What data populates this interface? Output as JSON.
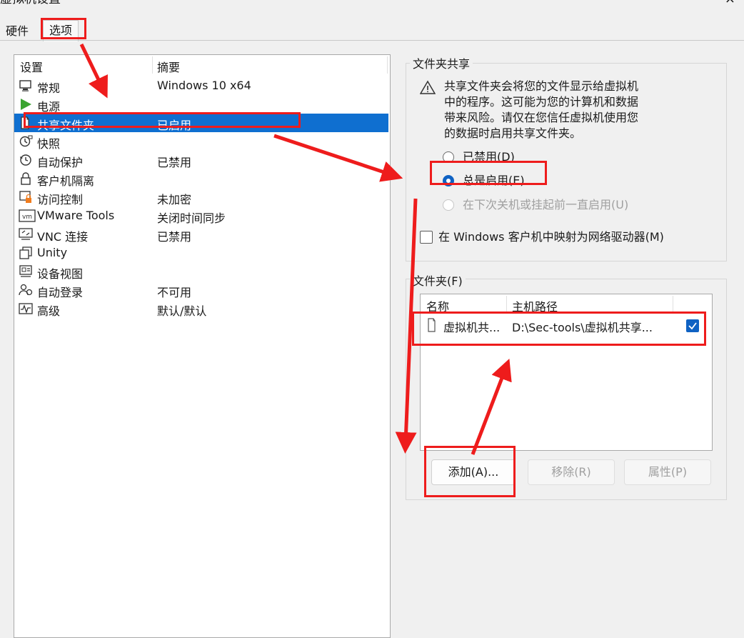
{
  "window": {
    "title": "虚拟机设置",
    "close_glyph": "×"
  },
  "tabs": [
    {
      "label": "硬件"
    },
    {
      "label": "选项"
    }
  ],
  "settings": {
    "header_setting": "设置",
    "header_summary": "摘要",
    "rows": [
      {
        "name": "常规",
        "summary": "Windows 10 x64",
        "icon": "general-icon"
      },
      {
        "name": "电源",
        "summary": "",
        "icon": "power-icon"
      },
      {
        "name": "共享文件夹",
        "summary": "已启用",
        "icon": "shared-folder-icon",
        "selected": true
      },
      {
        "name": "快照",
        "summary": "",
        "icon": "snapshot-icon"
      },
      {
        "name": "自动保护",
        "summary": "已禁用",
        "icon": "autoprotect-icon"
      },
      {
        "name": "客户机隔离",
        "summary": "",
        "icon": "isolation-icon"
      },
      {
        "name": "访问控制",
        "summary": "未加密",
        "icon": "access-control-icon"
      },
      {
        "name": "VMware Tools",
        "summary": "关闭时间同步",
        "icon": "vmware-tools-icon"
      },
      {
        "name": "VNC 连接",
        "summary": "已禁用",
        "icon": "vnc-icon"
      },
      {
        "name": "Unity",
        "summary": "",
        "icon": "unity-icon"
      },
      {
        "name": "设备视图",
        "summary": "",
        "icon": "device-view-icon"
      },
      {
        "name": "自动登录",
        "summary": "不可用",
        "icon": "autologin-icon"
      },
      {
        "name": "高级",
        "summary": "默认/默认",
        "icon": "advanced-icon"
      }
    ]
  },
  "folder_sharing": {
    "title": "文件夹共享",
    "warning_lines": [
      "共享文件夹会将您的文件显示给虚拟机",
      "中的程序。这可能为您的计算机和数据",
      "带来风险。请仅在您信任虚拟机使用您",
      "的数据时启用共享文件夹。"
    ],
    "options": [
      {
        "label": "已禁用(D)",
        "checked": false,
        "disabled": false
      },
      {
        "label": "总是启用(E)",
        "checked": true,
        "disabled": false
      },
      {
        "label": "在下次关机或挂起前一直启用(U)",
        "checked": false,
        "disabled": true
      }
    ],
    "map_drive_label": "在 Windows 客户机中映射为网络驱动器(M)",
    "map_drive_checked": false
  },
  "folders": {
    "title": "文件夹(F)",
    "col_name": "名称",
    "col_path": "主机路径",
    "items": [
      {
        "name": "虚拟机共...",
        "path": "D:\\Sec-tools\\虚拟机共享...",
        "enabled": true
      }
    ],
    "add_label": "添加(A)...",
    "remove_label": "移除(R)",
    "props_label": "属性(P)"
  },
  "colors": {
    "selection": "#0f6fd0",
    "annotation": "#ee1c1c",
    "accent": "#0f62c3"
  }
}
